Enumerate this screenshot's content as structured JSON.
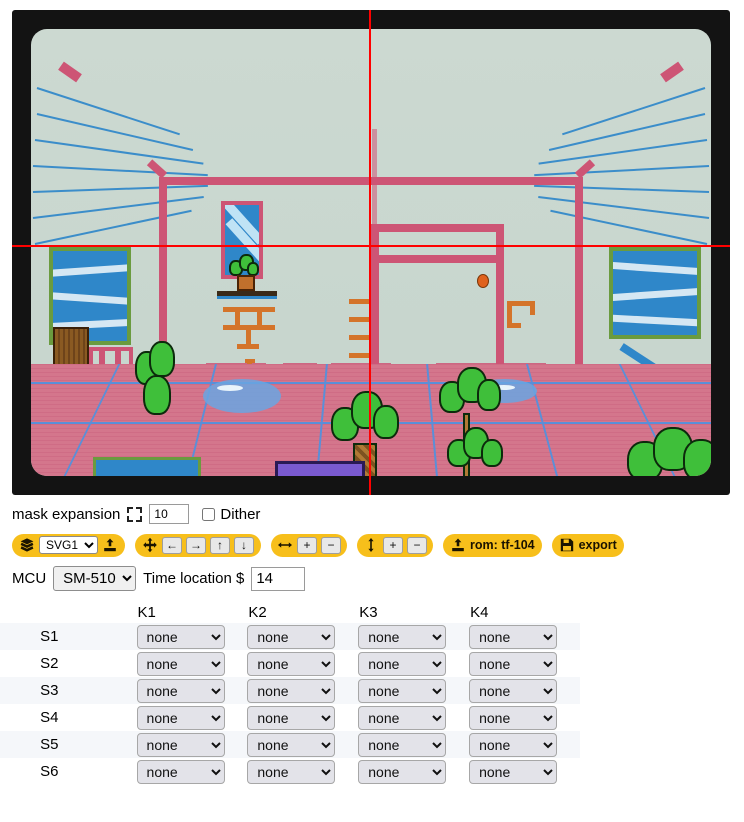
{
  "preview": {
    "name": "lcd-screen-preview",
    "crosshair_color": "#ff0000",
    "frame_color": "#131313",
    "lcd_background": "#c9d7cf"
  },
  "mask_row": {
    "label": "mask expansion",
    "expand_icon": "expand-corners-icon",
    "mask_value": "10",
    "dither_label": "Dither",
    "dither_checked": false
  },
  "toolbar": {
    "accent_color": "#f7bf1b",
    "layer_group": {
      "layers_icon": "layers-icon",
      "selected_layer": "SVG1",
      "layer_options": [
        "SVG1"
      ],
      "upload_icon": "upload-icon"
    },
    "move_group": {
      "move_icon": "move-arrows-icon",
      "buttons": [
        {
          "name": "move-left-button",
          "glyph": "←"
        },
        {
          "name": "move-right-button",
          "glyph": "→"
        },
        {
          "name": "move-up-button",
          "glyph": "↑"
        },
        {
          "name": "move-down-button",
          "glyph": "↓"
        }
      ]
    },
    "width_group": {
      "icon": "horizontal-resize-icon",
      "buttons": [
        {
          "name": "width-increase-button",
          "glyph": "+"
        },
        {
          "name": "width-decrease-button",
          "glyph": "−"
        }
      ]
    },
    "height_group": {
      "icon": "vertical-resize-icon",
      "buttons": [
        {
          "name": "height-increase-button",
          "glyph": "+"
        },
        {
          "name": "height-decrease-button",
          "glyph": "−"
        }
      ]
    },
    "rom_button": {
      "icon": "upload-icon",
      "label": "rom: tf-104"
    },
    "export_button": {
      "icon": "save-disk-icon",
      "label": "export"
    }
  },
  "mcu_row": {
    "mcu_label": "MCU",
    "mcu_value": "SM-510",
    "mcu_options": [
      "SM-510"
    ],
    "time_label": "Time location $",
    "time_value": "14"
  },
  "matrix": {
    "columns": [
      "K1",
      "K2",
      "K3",
      "K4"
    ],
    "rows": [
      {
        "label": "S1",
        "values": [
          "none",
          "none",
          "none",
          "none"
        ]
      },
      {
        "label": "S2",
        "values": [
          "none",
          "none",
          "none",
          "none"
        ]
      },
      {
        "label": "S3",
        "values": [
          "none",
          "none",
          "none",
          "none"
        ]
      },
      {
        "label": "S4",
        "values": [
          "none",
          "none",
          "none",
          "none"
        ]
      },
      {
        "label": "S5",
        "values": [
          "none",
          "none",
          "none",
          "none"
        ]
      },
      {
        "label": "S6",
        "values": [
          "none",
          "none",
          "none",
          "none"
        ]
      }
    ],
    "cell_options": [
      "none"
    ]
  }
}
